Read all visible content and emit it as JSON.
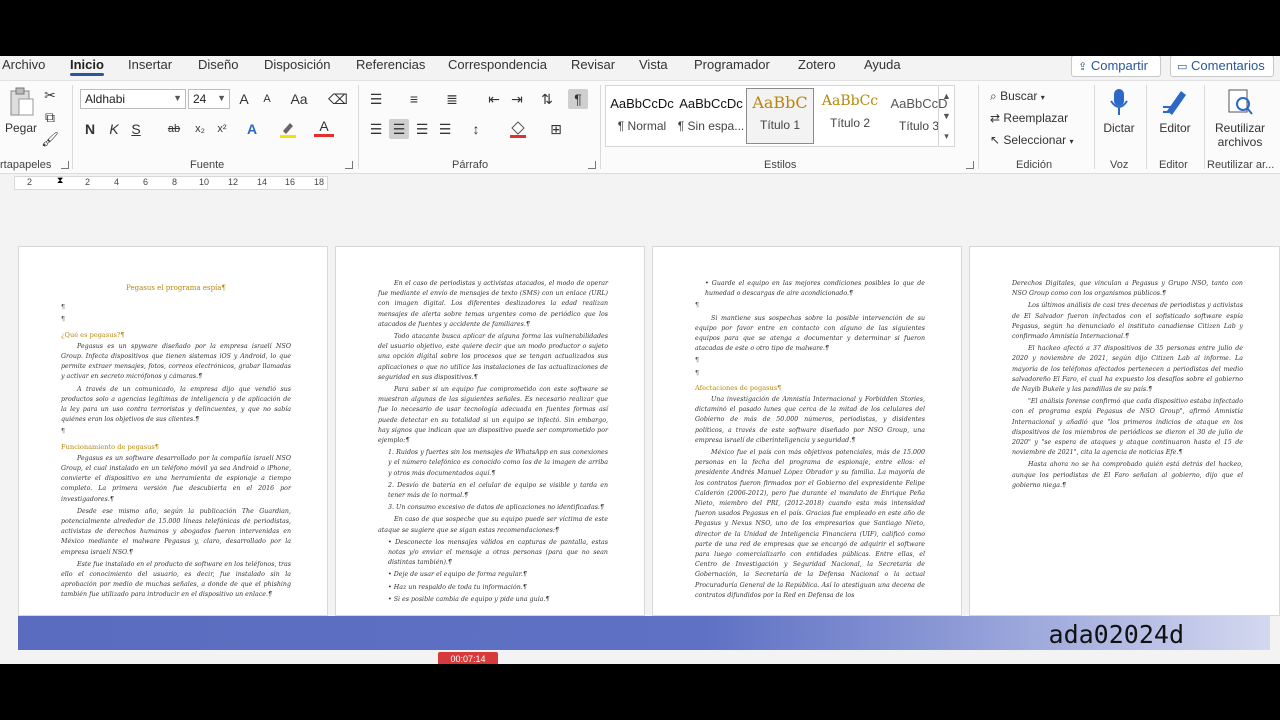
{
  "tabs": [
    "Archivo",
    "Inicio",
    "Insertar",
    "Diseño",
    "Disposición",
    "Referencias",
    "Correspondencia",
    "Revisar",
    "Vista",
    "Programador",
    "Zotero",
    "Ayuda"
  ],
  "actions": {
    "share": "Compartir",
    "comments": "Comentarios"
  },
  "ribbon": {
    "clipboard": {
      "paste": "Pegar",
      "label": "rtapapeles"
    },
    "font": {
      "name": "Aldhabi",
      "size": "24",
      "label": "Fuente",
      "bold": "N",
      "italic": "K",
      "underline": "S",
      "strike": "ab",
      "sub": "x₂",
      "sup": "x²",
      "grow": "A",
      "shrink": "A",
      "case": "Aa",
      "effects": "A",
      "font_color": "A"
    },
    "paragraph": {
      "label": "Párrafo"
    },
    "styles": {
      "label": "Estilos",
      "items": [
        {
          "sample": "AaBbCcDc",
          "name": "¶ Normal"
        },
        {
          "sample": "AaBbCcDc",
          "name": "¶ Sin espa..."
        },
        {
          "sample": "AaBbC",
          "name": "Título 1"
        },
        {
          "sample": "AaBbCc",
          "name": "Título 2"
        },
        {
          "sample": "AaBbCcD",
          "name": "Título 3"
        }
      ]
    },
    "editing": {
      "label": "Edición",
      "find": "Buscar",
      "replace": "Reemplazar",
      "select": "Seleccionar"
    },
    "voice": {
      "label": "Voz",
      "dictate": "Dictar"
    },
    "editor": {
      "label": "Editor",
      "editor": "Editor"
    },
    "reuse": {
      "label": "Reutilizar ar...",
      "reuse_files_1": "Reutilizar",
      "reuse_files_2": "archivos"
    }
  },
  "ruler": [
    "2",
    "2",
    "4",
    "6",
    "8",
    "10",
    "12",
    "14",
    "16",
    "18"
  ],
  "pages": {
    "p1": {
      "title": "Pegasus el programa espía¶",
      "h1": "¿Qué es pegasus?¶",
      "t1": "Pegasus es un spyware diseñado por la empresa israelí NSO Group. Infecta dispositivos que tienen sistemas iOS y Android, lo que permite extraer mensajes, fotos, correos electrónicos, grabar llamadas y activar en secreto micrófonos y cámaras.¶",
      "t2": "A través de un comunicado, la empresa dijo que vendió sus productos solo a agencias legítimas de inteligencia y de aplicación de la ley para un uso contra terroristas y delincuentes, y que no sabía quiénes eran los objetivos de sus clientes.¶",
      "h2": "Funcionamiento de pegasus¶",
      "t3": "Pegasus es un software desarrollado por la compañía israelí NSO Group, el cual instalado en un teléfono móvil ya sea Android o iPhone, convierte el dispositivo en una herramienta de espionaje a tiempo completo. La primera versión fue descubierta en el 2016 por investigadores.¶",
      "t4": "Desde ese mismo año, según la publicación The Guardian, potencialmente alrededor de 15.000 líneas telefónicas de periodistas, activistas de derechos humanos y abogados fueron intervenidas en México mediante el malware Pegasus y, claro, desarrollado por la empresa israelí NSO.¶",
      "t5": "Este fue instalado en el producto de software en los teléfonos, tras ello el conocimiento del usuario, es decir, fue instalado sin la aprobación por medio de muchas señales, a donde de que el phishing también fue utilizado para introducir en el dispositivo un enlace.¶"
    },
    "p2": {
      "t1": "En el caso de periodistas y activistas atacados, el modo de operar fue mediante el envío de mensajes de texto (SMS) con un enlace (URL) con imagen digital. Los diferentes deslizadores la edad realizan mensajes de alerta sobre temas urgentes como de periódico que los atacados de fuentes y accidente de familiares.¶",
      "t2": "Todo atacante busca aplicar de alguna forma las vulnerabilidades del usuario objetivo, este quiere decir que un modo productor o sujeto una opción digital sobre los procesos que se tengan actualizados sus aplicaciones o que no utilice las instalaciones de las actualizaciones de seguridad en sus dispositivos.¶",
      "t3": "Para saber si un equipo fue comprometido con este software se muestran algunas de las siguientes señales. Es necesario realizar que fue lo necesario de usar tecnología adecuada en fuentes formas así puede detectar en su totalidad si un equipo se infectó. Sin embargo, hay signos que indican que un dispositivo puede ser comprometido por ejemplo:¶",
      "l1": "1. Ruidos y fuertes sin los mensajes de WhatsApp en sus conexiones y el número telefónico es conocido como los de la imagen de arriba y otros más documentados aquí.¶",
      "l2": "2. Desvío de batería en el celular de equipo se visible y tarda en tener más de lo normal.¶",
      "l3": "3. Un consumo excesivo de datos de aplicaciones no identificadas.¶",
      "t4": "En caso de que sospeche que su equipo puede ser víctima de este ataque se sugiere que se sigan estas recomendaciones:¶",
      "b1": "• Desconecte los mensajes válidos en capturas de pantalla, estas notas y/o enviar el mensaje a otras personas (para que no sean distintas también).¶",
      "b2": "• Deje de usar el equipo de forma regular.¶",
      "b3": "• Haz un respaldo de toda tu información.¶",
      "b4": "• Si es posible cambia de equipo y pide una guía.¶"
    },
    "p3": {
      "b1": "• Guarde el equipo en las mejores condiciones posibles lo que de humedad o descargas de aire acondicionado.¶",
      "t1": "Si mantiene sus sospechas sobre la posible intervención de su equipo por favor entre en contacto con alguno de las siguientes equipos para que se atenga a documentar y determinar si fueron atacadas de este o otro tipo de malware.¶",
      "h1": "Afectaciones de pegasus¶",
      "t2": "Una investigación de Amnistía Internacional y Forbidden Stories, dictaminó el pasado lunes que cerca de la mitad de los celulares del Gobierno de más de 50.000 números, periodistas, y disidentes políticos, a través de este software diseñado por NSO Group, una empresa israelí de ciberinteligencia y seguridad.¶",
      "t3": "México fue el país con más objetivos potenciales, más de 15.000 personas en la fecha del programa de espionaje, entre ellos: el presidente Andrés Manuel López Obrador y su familia. La mayoría de los contratos fueron firmados por el Gobierno del expresidente Felipe Calderón (2006-2012), pero fue durante el mandato de Enrique Peña Nieto, miembro del PRI, (2012-2018) cuando esta más intensidad fueron usados Pegasus en el país. Gracias fue empleado en este año de Pegasus y Nexus NSO, uno de los empresarios que Santiago Nieto, director de la Unidad de Inteligencia Financiera (UIF), calificó como parte de una red de empresas que se encargó de adquirir el software para luego comercializarlo con entidades públicas. Entre ellas, el Centro de Investigación y Seguridad Nacional, la Secretaría de Gobernación, la Secretaría de la Defensa Nacional o la actual Procuraduría General de la República. Así lo atestiguan una decena de contratos difundidos por la Red en Defensa de los"
    },
    "p4": {
      "t1": "Derechos Digitales, que vinculan a Pegasus y Grupo NSO, tanto con NSO Group como con los organismos públicos.¶",
      "t2": "Los últimos análisis de casi tres decenas de periodistas y activistas de El Salvador fueron infectados con el sofisticado software espía Pegasus, según ha denunciado el instituto canadiense Citizen Lab y confirmado Amnistía Internacional.¶",
      "t3": "El hackeo afectó a 37 dispositivos de 35 personas entre julio de 2020 y noviembre de 2021, según dijo Citizen Lab al informe. La mayoría de los teléfonos afectados pertenecen a periodistas del medio salvadoreño El Faro, el cual ha expuesto los desafíos sobre el gobierno de Nayib Bukele y las pandillas de su país.¶",
      "t4": "\"El análisis forense confirmó que cada dispositivo estaba infectado con el programa espía Pegasus de NSO Group\", afirmó Amnistía Internacional y añadió que \"los primeros indicios de ataque en los dispositivos de los miembros de periódicos se dieron el 30 de julio de 2020\" y \"se espera de ataques y ataque continuaron hasta el 15 de noviembre de 2021\", cita la agencia de noticias Efe.¶",
      "t5": "Hasta ahora no se ha comprobado quién está detrás del hackeo, aunque los periodistas de El Faro señalan al gobierno, dijo que el gobierno niega.¶"
    }
  },
  "watermark": "ada02024d",
  "timer": "00:07:14"
}
